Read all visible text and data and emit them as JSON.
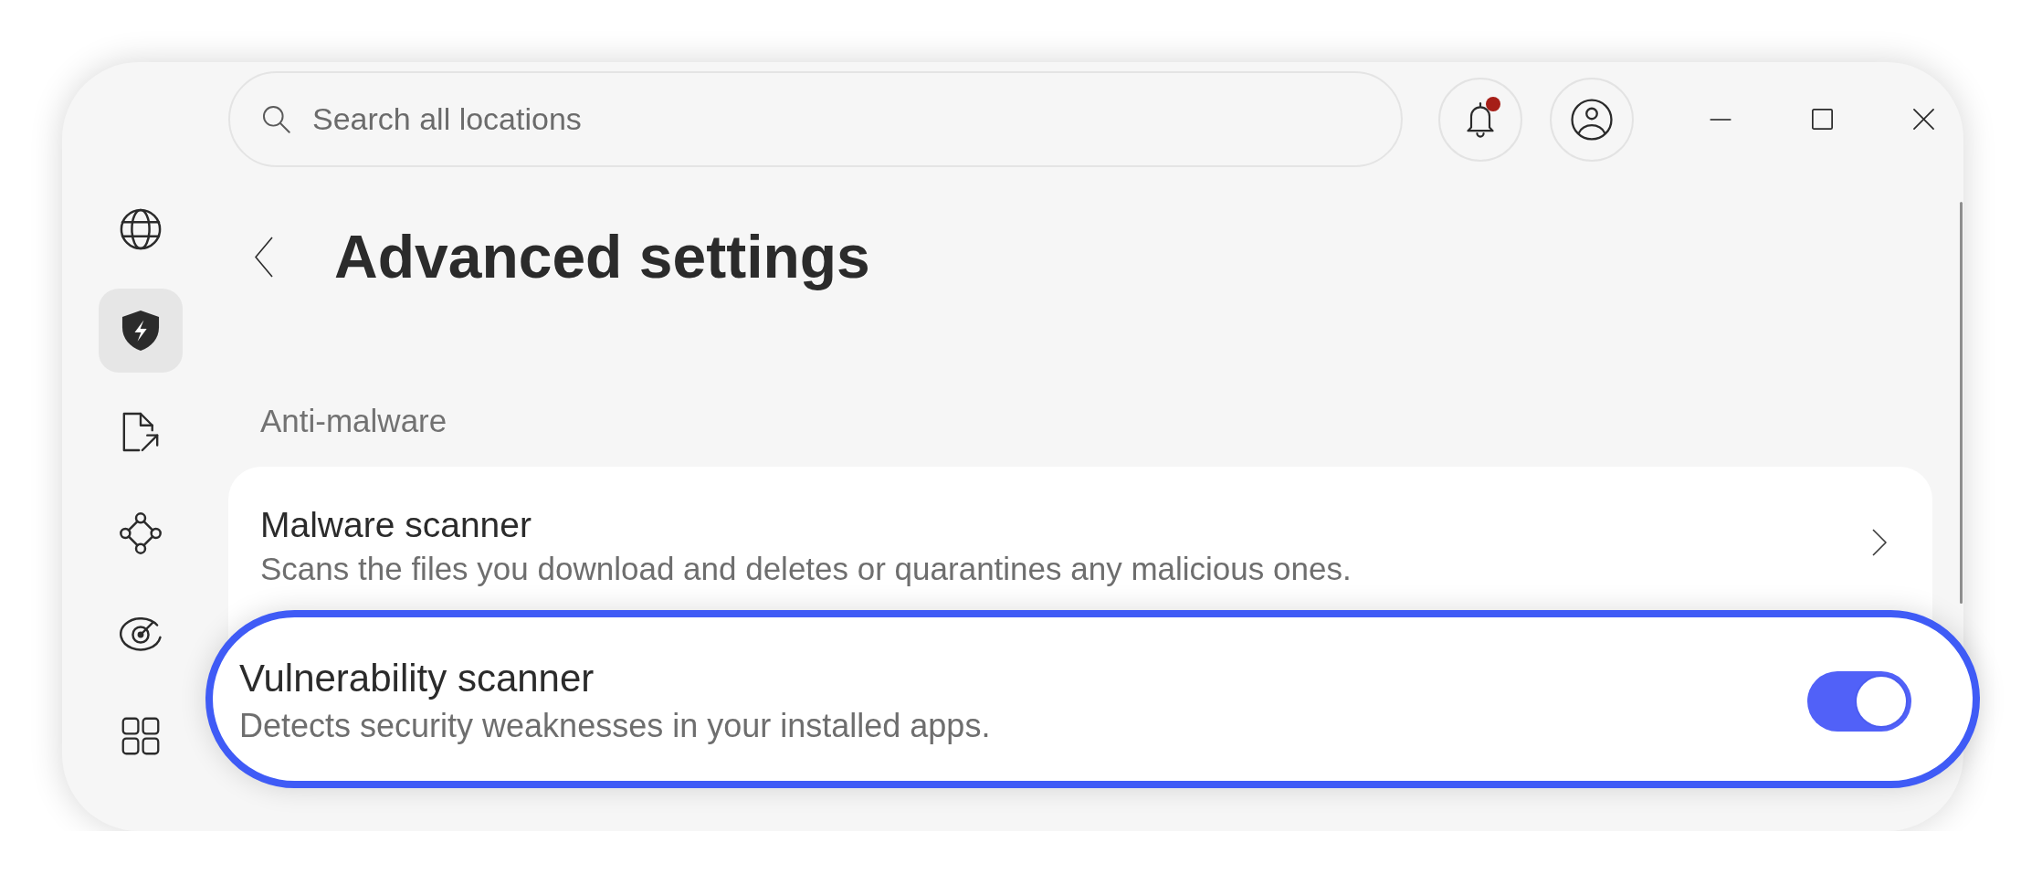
{
  "topbar": {
    "search": {
      "placeholder": "Search all locations"
    },
    "notifications": {
      "unread": true
    }
  },
  "sidebar": {
    "items": [
      {
        "selected": false
      },
      {
        "selected": true
      },
      {
        "selected": false
      },
      {
        "selected": false
      },
      {
        "selected": false
      },
      {
        "selected": false
      }
    ]
  },
  "page": {
    "title": "Advanced settings"
  },
  "section": {
    "heading": "Anti-malware",
    "settings": [
      {
        "kind": "link",
        "title": "Malware scanner",
        "description": "Scans the files you download and deletes or quarantines any malicious ones.",
        "highlighted": false
      },
      {
        "kind": "toggle",
        "title": "Vulnerability scanner",
        "description": "Detects security weaknesses in your installed apps.",
        "on": true,
        "highlighted": true
      }
    ]
  }
}
